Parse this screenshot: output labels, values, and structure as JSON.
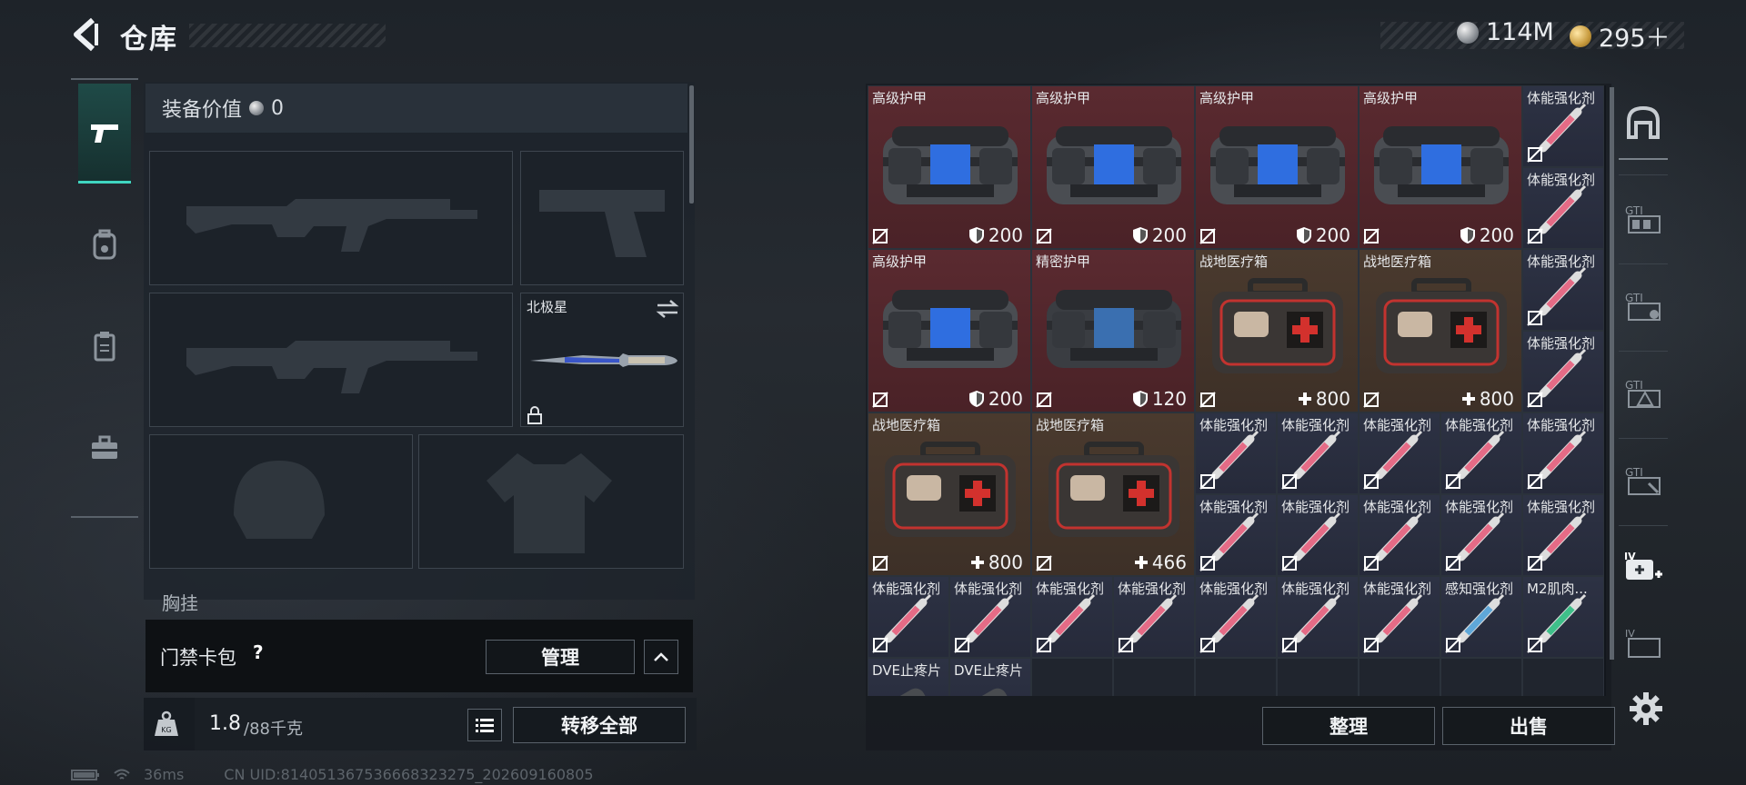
{
  "header": {
    "title": "仓库"
  },
  "currency": {
    "silver": "114M",
    "gold": "295＋"
  },
  "equipment": {
    "value_label": "装备价值",
    "value": "0",
    "melee_name": "北极星",
    "chest_label": "胸挂"
  },
  "keycard": {
    "label": "门禁卡包",
    "help": "?",
    "manage": "管理"
  },
  "weight": {
    "current": "1.8",
    "max": "/88千克",
    "transfer_all": "转移全部"
  },
  "footer": {
    "ping": "36ms",
    "uid": "CN UID:814051367536668323275_202609160805"
  },
  "storage": {
    "items": [
      {
        "name": "高级护甲",
        "value": "200",
        "kind": "armor",
        "stat": "shield"
      },
      {
        "name": "高级护甲",
        "value": "200",
        "kind": "armor",
        "stat": "shield"
      },
      {
        "name": "高级护甲",
        "value": "200",
        "kind": "armor",
        "stat": "shield"
      },
      {
        "name": "高级护甲",
        "value": "200",
        "kind": "armor",
        "stat": "shield"
      },
      {
        "name": "高级护甲",
        "value": "200",
        "kind": "armor",
        "stat": "shield"
      },
      {
        "name": "精密护甲",
        "value": "120",
        "kind": "armor2",
        "stat": "shield"
      },
      {
        "name": "战地医疗箱",
        "value": "800",
        "kind": "medkit",
        "stat": "plus"
      },
      {
        "name": "战地医疗箱",
        "value": "800",
        "kind": "medkit",
        "stat": "plus"
      },
      {
        "name": "战地医疗箱",
        "value": "800",
        "kind": "medkit",
        "stat": "plus"
      },
      {
        "name": "战地医疗箱",
        "value": "466",
        "kind": "medkit",
        "stat": "plus"
      }
    ],
    "small_items": [
      "体能强化剂",
      "体能强化剂",
      "体能强化剂",
      "体能强化剂",
      "体能强化剂",
      "体能强化剂",
      "体能强化剂",
      "体能强化剂",
      "体能强化剂",
      "体能强化剂",
      "体能强化剂",
      "体能强化剂",
      "体能强化剂",
      "体能强化剂",
      "体能强化剂",
      "体能强化剂",
      "体能强化剂",
      "体能强化剂",
      "体能强化剂",
      "体能强化剂",
      "体能强化剂",
      "感知强化剂",
      "M2肌肉...",
      "DVE止疼片",
      "DVE止疼片"
    ],
    "sort": "整理",
    "sell": "出售"
  },
  "colors": {
    "accent": "#3fd6c0",
    "armor_bg": "#5a2a30",
    "medkit_bg": "#4a3a2e",
    "small_bg": "#2d3244"
  },
  "icons": {
    "rail": [
      "pistol-icon",
      "backpack-icon",
      "clipboard-icon",
      "toolbox-icon"
    ],
    "side_tabs": [
      "home-icon",
      "storage-tab-1-icon",
      "storage-tab-2-icon",
      "storage-tab-3-icon",
      "storage-tab-4-icon",
      "add-storage-icon",
      "storage-tab-5-icon"
    ]
  }
}
